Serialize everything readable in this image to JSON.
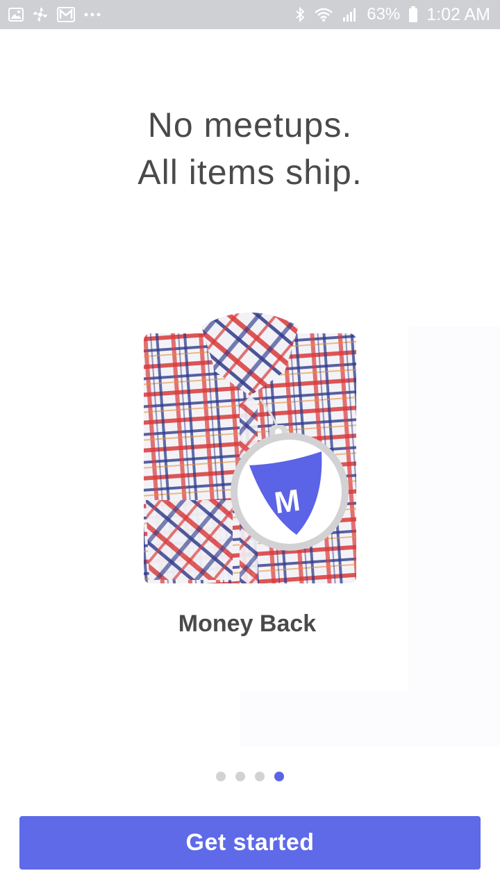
{
  "status_bar": {
    "left_icons": [
      "gallery-icon",
      "pinwheel-icon",
      "mercari-icon",
      "more-icon"
    ],
    "right_icons": [
      "bluetooth-icon",
      "wifi-icon",
      "signal-icon",
      "battery-icon"
    ],
    "battery": "63%",
    "time": "1:02 AM"
  },
  "headline": {
    "line1": "No meetups.",
    "line2": "All items ship."
  },
  "illustration": {
    "description_icon": "shirt-with-shield-tag-icon",
    "badge_letter": "M"
  },
  "caption": "Money Back",
  "pager": {
    "count": 4,
    "active_index": 3
  },
  "cta": {
    "label": "Get started"
  },
  "colors": {
    "accent": "#5e6ae8",
    "headline_text": "#4a4a4a",
    "status_bar": "#cfd0d3",
    "dot_inactive": "#d2d2d4"
  }
}
